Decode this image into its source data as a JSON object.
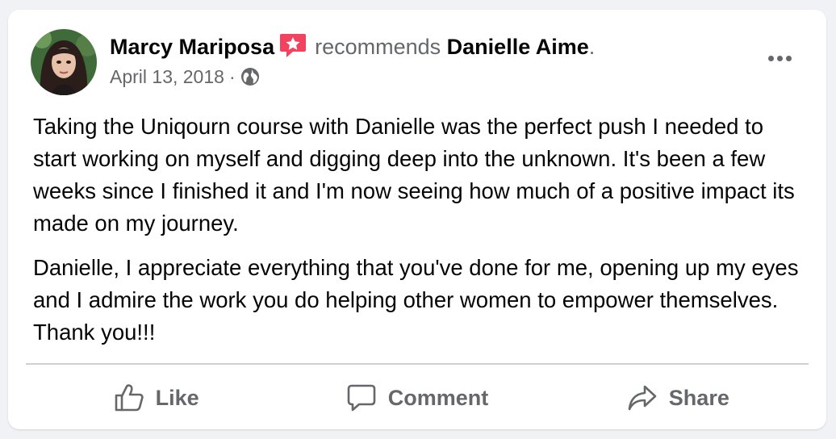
{
  "post": {
    "author": "Marcy Mariposa",
    "verb": "recommends",
    "target": "Danielle Aime",
    "period": ".",
    "date": "April 13, 2018",
    "separator": "·",
    "privacy_icon": "globe-icon",
    "badge_icon": "star-badge-icon",
    "paragraphs": [
      "Taking the Uniqourn course with Danielle was the perfect push I needed to start working on myself and digging deep into the unknown. It's been a few weeks since I finished it and I'm now seeing how much of a positive impact its made on my journey.",
      "Danielle, I appreciate everything that you've done for me, opening up my eyes and I admire the work you do helping other women to empower themselves. Thank you!!!"
    ]
  },
  "actions": {
    "like": "Like",
    "comment": "Comment",
    "share": "Share"
  },
  "colors": {
    "primary_text": "#050505",
    "secondary_text": "#65676b",
    "badge": "#f3425f",
    "divider": "#ced0d4"
  }
}
